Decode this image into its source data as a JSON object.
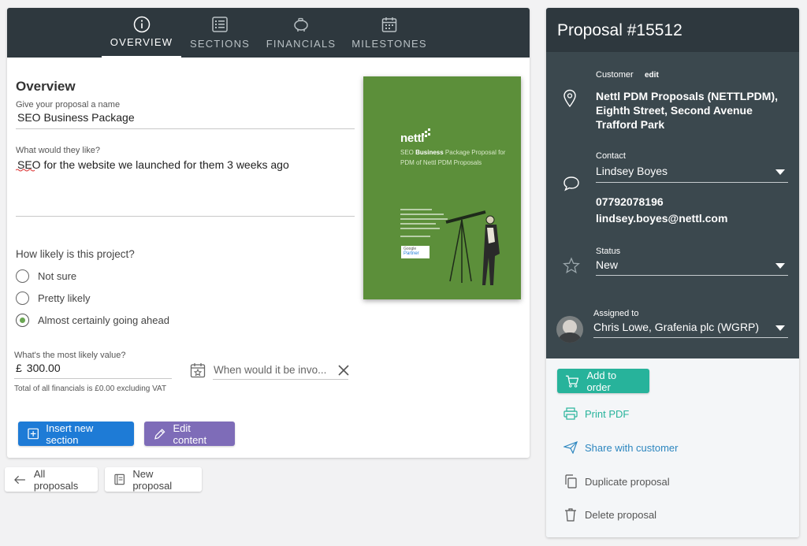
{
  "tabs": [
    {
      "label": "OVERVIEW",
      "icon": "info-icon"
    },
    {
      "label": "SECTIONS",
      "icon": "list-icon"
    },
    {
      "label": "FINANCIALS",
      "icon": "piggy-bank-icon"
    },
    {
      "label": "MILESTONES",
      "icon": "calendar-icon"
    }
  ],
  "overview": {
    "heading": "Overview",
    "name_label": "Give your proposal a name",
    "name_value": "SEO Business Package",
    "like_label": "What would they like?",
    "like_value": "SEO for the website we launched for them 3 weeks ago",
    "likely_question": "How likely is this project?",
    "likely_options": [
      "Not sure",
      "Pretty likely",
      "Almost certainly going ahead"
    ],
    "likely_selected": "Almost certainly going ahead",
    "value_label": "What's the most likely value?",
    "currency": "£",
    "value": "300.00",
    "when_placeholder": "When would it be invo...",
    "financials_note": "Total of all financials is £0.00 excluding VAT"
  },
  "cover": {
    "brand": "nettl",
    "title_part1": "SEO ",
    "title_bold": "Business",
    "title_part2": " Package Proposal for",
    "title_line2": "PDM of Nettl PDM Proposals",
    "badge_line1": "Google",
    "badge_line2": "Partner"
  },
  "buttons": {
    "insert_section": "Insert new section",
    "edit_content": "Edit content",
    "all_proposals": "All proposals",
    "new_proposal": "New proposal"
  },
  "proposal": {
    "title": "Proposal #15512",
    "customer_label": "Customer",
    "customer_edit": "edit",
    "customer_value": "Nettl PDM Proposals (NETTLPDM), Eighth Street, Second Avenue Trafford Park",
    "contact_label": "Contact",
    "contact_value": "Lindsey Boyes",
    "contact_phone": "07792078196",
    "contact_email": "lindsey.boyes@nettl.com",
    "status_label": "Status",
    "status_value": "New",
    "assigned_label": "Assigned to",
    "assigned_value": "Chris Lowe, Grafenia plc (WGRP)"
  },
  "actions": {
    "add_to_order": "Add to order",
    "print_pdf": "Print PDF",
    "share": "Share with customer",
    "duplicate": "Duplicate proposal",
    "delete": "Delete proposal"
  },
  "colors": {
    "dark": "#2e383e",
    "panel": "#3b484e",
    "primary": "#1e7bd6",
    "purple": "#7e6cb8",
    "teal": "#27b39b",
    "link": "#2c86bf",
    "cover_green": "#5c8f3a"
  }
}
